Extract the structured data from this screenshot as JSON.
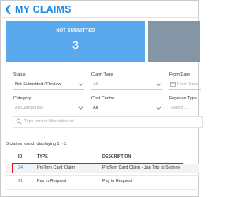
{
  "header": {
    "title": "MY CLAIMS",
    "accent": "#1e88e5"
  },
  "summary": {
    "label": "NOT SUBMITTED",
    "count": "3",
    "tile_color": "#5aa9ee",
    "secondary_color": "#8496a6"
  },
  "filters": {
    "status": {
      "label": "Status",
      "value": "Not Submitted / Review"
    },
    "claim_type": {
      "label": "Claim Type",
      "value": "All"
    },
    "from_date": {
      "label": "From Date",
      "placeholder": "From Date"
    },
    "category": {
      "label": "Category",
      "value": "All Categories"
    },
    "cost_centre": {
      "label": "Cost Centre",
      "value": "All"
    },
    "expense_type": {
      "label": "Expense Type",
      "value": "Select ..."
    }
  },
  "search": {
    "placeholder": "Type here to filter claim list"
  },
  "results_text": "3 claims found, displaying 1 - 3.",
  "table": {
    "columns": [
      "ID",
      "TYPE",
      "DESCRIPTION"
    ],
    "rows": [
      {
        "id": "24",
        "type": "ProTem Card Claim",
        "description": "ProTem Card Claim - Jan Trip to Sydney"
      },
      {
        "id": "21",
        "type": "Pay in Request",
        "description": "Pay in Request"
      }
    ],
    "highlight_color": "#e0141f"
  }
}
